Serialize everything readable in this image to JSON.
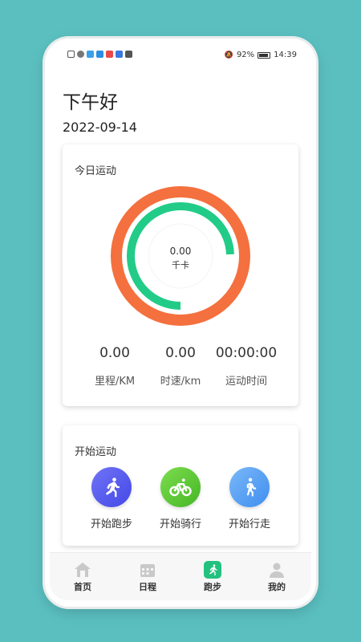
{
  "status_bar": {
    "battery": "92%",
    "time": "14:39"
  },
  "header": {
    "greeting": "下午好",
    "date": "2022-09-14"
  },
  "today": {
    "title": "今日运动",
    "calories_value": "0.00",
    "calories_unit": "千卡",
    "ring_colors": {
      "outer": "#f4703e",
      "inner": "#22cc88"
    },
    "stats": [
      {
        "value": "0.00",
        "label": "里程/KM"
      },
      {
        "value": "0.00",
        "label": "时速/km"
      },
      {
        "value": "00:00:00",
        "label": "运动时间"
      }
    ]
  },
  "start": {
    "title": "开始运动",
    "actions": [
      {
        "label": "开始跑步",
        "icon": "running-icon",
        "color": "#5b5ef2"
      },
      {
        "label": "开始骑行",
        "icon": "cycling-icon",
        "color": "#5cc93a"
      },
      {
        "label": "开始行走",
        "icon": "walking-icon",
        "color": "#4a9df3"
      }
    ]
  },
  "tabs": [
    {
      "label": "首页",
      "icon": "home-icon"
    },
    {
      "label": "日程",
      "icon": "calendar-icon"
    },
    {
      "label": "跑步",
      "icon": "running-icon",
      "active": true
    },
    {
      "label": "我的",
      "icon": "user-icon"
    }
  ]
}
